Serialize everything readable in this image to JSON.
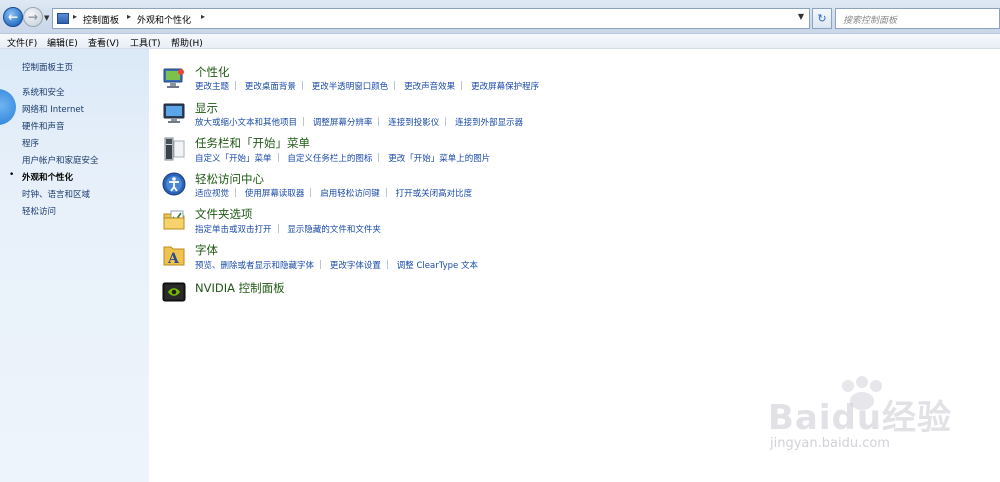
{
  "address_bar": {
    "crumbs": [
      "控制面板",
      "外观和个性化"
    ],
    "search_placeholder": "搜索控制面板"
  },
  "menu": [
    "文件(F)",
    "编辑(E)",
    "查看(V)",
    "工具(T)",
    "帮助(H)"
  ],
  "sidebar": {
    "items": [
      {
        "label": "控制面板主页",
        "current": false
      },
      {
        "label": "系统和安全",
        "current": false
      },
      {
        "label": "网络和 Internet",
        "current": false
      },
      {
        "label": "硬件和声音",
        "current": false
      },
      {
        "label": "程序",
        "current": false
      },
      {
        "label": "用户帐户和家庭安全",
        "current": false
      },
      {
        "label": "外观和个性化",
        "current": true
      },
      {
        "label": "时钟、语言和区域",
        "current": false
      },
      {
        "label": "轻松访问",
        "current": false
      }
    ]
  },
  "categories": [
    {
      "title": "个性化",
      "icon": "personalization-icon",
      "links": [
        "更改主题",
        "更改桌面背景",
        "更改半透明窗口颜色",
        "更改声音效果",
        "更改屏幕保护程序"
      ]
    },
    {
      "title": "显示",
      "icon": "display-icon",
      "links": [
        "放大或缩小文本和其他项目",
        "调整屏幕分辨率",
        "连接到投影仪",
        "连接到外部显示器"
      ]
    },
    {
      "title": "任务栏和「开始」菜单",
      "icon": "taskbar-icon",
      "links": [
        "自定义「开始」菜单",
        "自定义任务栏上的图标",
        "更改「开始」菜单上的图片"
      ]
    },
    {
      "title": "轻松访问中心",
      "icon": "ease-of-access-icon",
      "links": [
        "适应视觉",
        "使用屏幕读取器",
        "启用轻松访问键",
        "打开或关闭高对比度"
      ]
    },
    {
      "title": "文件夹选项",
      "icon": "folder-options-icon",
      "links": [
        "指定单击或双击打开",
        "显示隐藏的文件和文件夹"
      ]
    },
    {
      "title": "字体",
      "icon": "fonts-icon",
      "links": [
        "预览、删除或者显示和隐藏字体",
        "更改字体设置",
        "调整 ClearType 文本"
      ]
    },
    {
      "title": "NVIDIA 控制面板",
      "icon": "nvidia-icon",
      "links": []
    }
  ],
  "watermark": {
    "brand": "Baidu经验",
    "url": "jingyan.baidu.com"
  }
}
